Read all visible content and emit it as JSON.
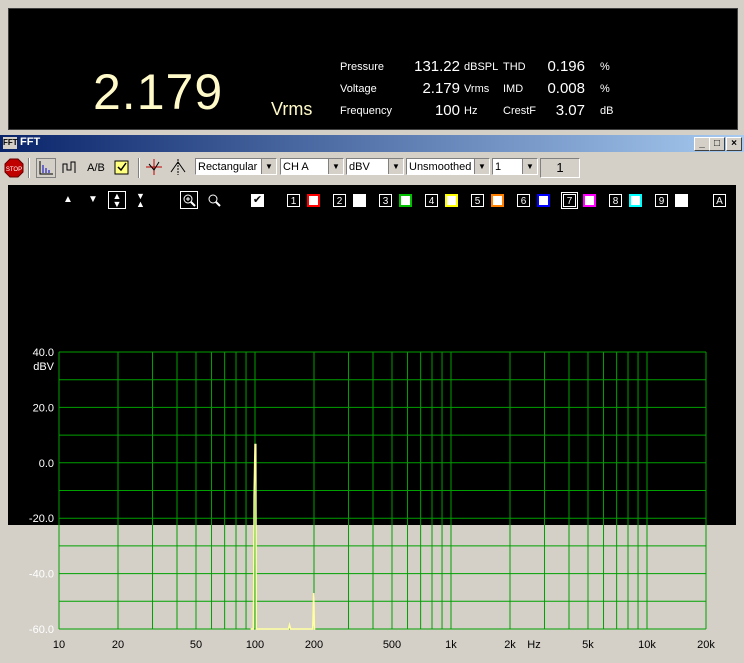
{
  "meter": {
    "main_value": "2.179",
    "main_unit": "Vrms",
    "rows": [
      {
        "label": "Pressure",
        "value": "131.22",
        "unit": "dBSPL",
        "label2": "THD",
        "value2": "0.196",
        "unit2": "%"
      },
      {
        "label": "Voltage",
        "value": "2.179",
        "unit": "Vrms",
        "label2": "IMD",
        "value2": "0.008",
        "unit2": "%"
      },
      {
        "label": "Frequency",
        "value": "100",
        "unit": "Hz",
        "label2": "CrestF",
        "value2": "3.07",
        "unit2": "dB"
      }
    ]
  },
  "window": {
    "title": "FFT",
    "icon_text": "FFT",
    "min_label": "_",
    "max_label": "□",
    "close_label": "×"
  },
  "toolbar": {
    "stop_label": "STOP",
    "ab_label": "A/B",
    "window_select": "Rectangular",
    "channel_select": "CH A",
    "unit_select": "dBV",
    "smoothing_select": "Unsmoothed",
    "average_select": "1",
    "counter": "1"
  },
  "plot_controls": {
    "traces": [
      {
        "num": "1",
        "color": "#ff0000"
      },
      {
        "num": "2",
        "color": "#ffffff"
      },
      {
        "num": "3",
        "color": "#00c000"
      },
      {
        "num": "4",
        "color": "#ffff00"
      },
      {
        "num": "5",
        "color": "#ff8000"
      },
      {
        "num": "6",
        "color": "#0000ff"
      },
      {
        "num": "7",
        "color": "#ff00ff"
      },
      {
        "num": "8",
        "color": "#00ffff"
      },
      {
        "num": "9",
        "color": "#ffffff"
      }
    ],
    "a_label": "A"
  },
  "chart_data": {
    "type": "line",
    "xlabel": "Hz",
    "ylabel": "dBV",
    "xscale": "log",
    "xlim": [
      10,
      20000
    ],
    "ylim": [
      -60,
      40
    ],
    "x_ticks": [
      "10",
      "20",
      "50",
      "100",
      "200",
      "500",
      "1k",
      "2k",
      "5k",
      "10k",
      "20k"
    ],
    "y_ticks": [
      "40.0",
      "20.0",
      "0.0",
      "-20.0",
      "-40.0",
      "-60.0"
    ],
    "grid": true,
    "line_color": "#ffffa0",
    "grid_color": "#00a000",
    "series": [
      {
        "x": [
          95,
          97,
          98,
          98.5,
          99,
          100,
          101,
          101.5,
          102,
          103,
          145,
          148,
          150,
          152,
          155,
          197,
          198,
          199,
          200,
          201,
          202,
          203
        ],
        "y": [
          -60,
          -60,
          -60,
          -44,
          -12,
          6.6,
          6.6,
          -60,
          -60,
          -60,
          -60,
          -60,
          -58.5,
          -60,
          -60,
          -60,
          -55,
          -47,
          -52,
          -60,
          -60,
          -60
        ]
      }
    ]
  }
}
